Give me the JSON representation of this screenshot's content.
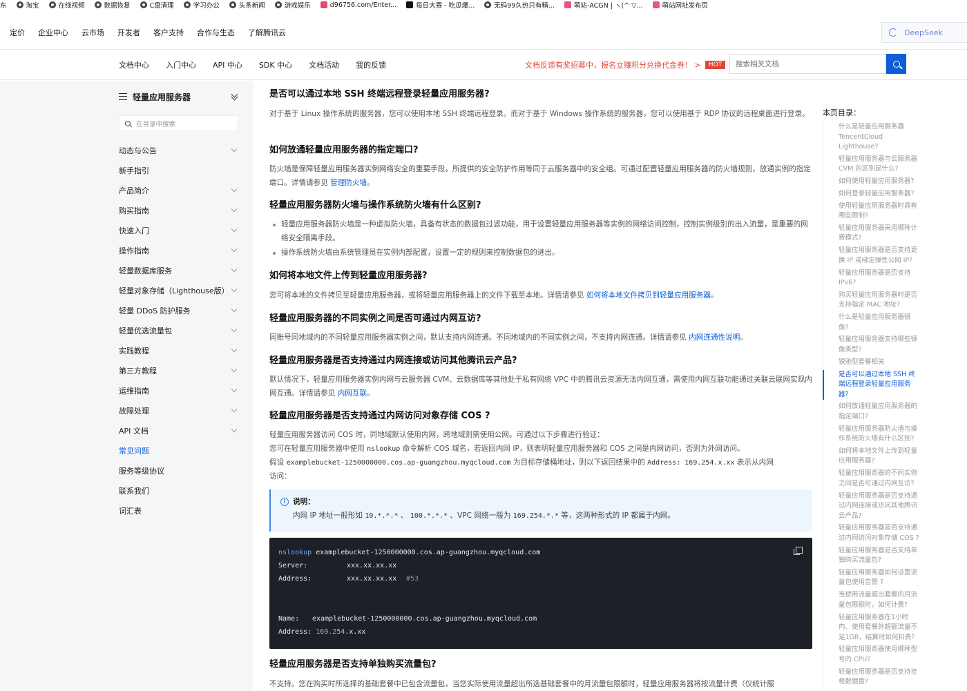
{
  "bookmarks": [
    {
      "label": "东",
      "icon": "none"
    },
    {
      "label": "淘宝",
      "icon": "globe-icon"
    },
    {
      "label": "在线视频",
      "icon": "globe-icon"
    },
    {
      "label": "数据恢复",
      "icon": "globe-icon"
    },
    {
      "label": "C盘清理",
      "icon": "globe-icon"
    },
    {
      "label": "学习办公",
      "icon": "globe-icon"
    },
    {
      "label": "头条新闻",
      "icon": "globe-icon"
    },
    {
      "label": "游戏娱乐",
      "icon": "globe-icon"
    },
    {
      "label": "d96756.com/Enter...",
      "icon": "site-icon"
    },
    {
      "label": "每日大赛 - 吃瓜爆...",
      "icon": "site-icon"
    },
    {
      "label": "无码99久热只有精...",
      "icon": "globe-icon"
    },
    {
      "label": "萌站-ACGN | ヽ(^ ▽...",
      "icon": "site-icon"
    },
    {
      "label": "萌站网址发布页",
      "icon": "site-icon"
    }
  ],
  "topnav": {
    "items": [
      "定价",
      "企业中心",
      "云市场",
      "开发者",
      "客户支持",
      "合作与生态",
      "了解腾讯云"
    ],
    "deepseek_label": "DeepSeek"
  },
  "docnav": {
    "tabs": [
      "文档中心",
      "入门中心",
      "API 中心",
      "SDK 中心",
      "文档活动",
      "我的反馈"
    ],
    "promo": "文档反馈有奖招募中，报名立赚积分兑换代金券！ >",
    "hot": "HOT",
    "search_placeholder": "搜索相关文档"
  },
  "sidebar": {
    "title": "轻量应用服务器",
    "search_placeholder": "在目录中搜索",
    "items": [
      {
        "label": "动态与公告",
        "expandable": true
      },
      {
        "label": "新手指引",
        "expandable": false
      },
      {
        "label": "产品简介",
        "expandable": true
      },
      {
        "label": "购买指南",
        "expandable": true
      },
      {
        "label": "快速入门",
        "expandable": true
      },
      {
        "label": "操作指南",
        "expandable": true
      },
      {
        "label": "轻量数据库服务",
        "expandable": true
      },
      {
        "label": "轻量对象存储（Lighthouse版）",
        "expandable": true
      },
      {
        "label": "轻量 DDoS 防护服务",
        "expandable": true
      },
      {
        "label": "轻量优选流量包",
        "expandable": true
      },
      {
        "label": "实践教程",
        "expandable": true
      },
      {
        "label": "第三方教程",
        "expandable": true
      },
      {
        "label": "运维指南",
        "expandable": true
      },
      {
        "label": "故障处理",
        "expandable": true
      },
      {
        "label": "API 文档",
        "expandable": true
      },
      {
        "label": "常见问题",
        "expandable": false,
        "active": true
      },
      {
        "label": "服务等级协议",
        "expandable": false
      },
      {
        "label": "联系我们",
        "expandable": false
      },
      {
        "label": "词汇表",
        "expandable": false
      }
    ]
  },
  "content": {
    "s1": {
      "heading": "是否可以通过本地 SSH 终端远程登录轻量应用服务器?",
      "body": "对于基于 Linux 操作系统的服务器，您可以使用本地 SSH 终端远程登录。而对于基于 Windows 操作系统的服务器，您可以使用基于 RDP 协议的远程桌面进行登录。"
    },
    "s2": {
      "heading": "如何放通轻量应用服务器的指定端口?",
      "body": "防火墙是保障轻量应用服务器实例网络安全的重要手段，所提供的安全防护作用等同于云服务器中的安全组。可通过配置轻量应用服务器的防火墙规则，放通实例的指定端口。详情请参见 ",
      "link": "管理防火墙",
      "tail": "。"
    },
    "s3": {
      "heading": "轻量应用服务器防火墙与操作系统防火墙有什么区别?",
      "bullets": [
        "轻量应用服务器防火墙是一种虚拟防火墙，具备有状态的数据包过滤功能，用于设置轻量应用服务器等实例的网络访问控制，控制实例级别的出入流量，是重要的网络安全隔离手段。",
        "操作系统防火墙由系统管理员在实例内部配置，设置一定的规则来控制数据包的进出。"
      ]
    },
    "s4": {
      "heading": "如何将本地文件上传到轻量应用服务器?",
      "body": "您可将本地的文件拷贝至轻量应用服务器，或将轻量应用服务器上的文件下载至本地。详情请参见 ",
      "link": "如何将本地文件拷贝到轻量应用服务器",
      "tail": "。"
    },
    "s5": {
      "heading": "轻量应用服务器的不同实例之间是否可通过内网互访?",
      "body": "同账号同地域内的不同轻量应用服务器实例之间，默认支持内网连通。不同地域内的不同实例之间，不支持内网连通。详情请参见 ",
      "link": "内网连通性说明",
      "tail": "。"
    },
    "s6": {
      "heading": "轻量应用服务器是否支持通过内网连接或访问其他腾讯云产品?",
      "body": "默认情况下，轻量应用服务器实例内网与云服务器 CVM、云数据库等其他处于私有网络 VPC 中的腾讯云资源无法内网互通，需使用内网互联功能通过关联云联网实现内网互通。详情请参见 ",
      "link": "内网互联",
      "tail": "。"
    },
    "s7": {
      "heading": "轻量应用服务器是否支持通过内网访问对象存储 COS ?",
      "line1": "轻量应用服务器访问 COS 时，同地域默认使用内网，跨地域则需使用公网。可通过以下步骤进行验证：",
      "line2_a": "您可在轻量应用服务器中使用 ",
      "line2_code": "nslookup",
      "line2_b": " 命令解析 COS 域名，若返回内网 IP，则表明轻量应用服务器和 COS 之间是内网访问，否则为外网访问。",
      "line3_a": "假设 ",
      "line3_code1": "examplebucket-1250000000.cos.ap-guangzhou.myqcloud.com",
      "line3_b": " 为目标存储桶地址，则以下返回结果中的 ",
      "line3_code2": "Address: 169.254.x.xx",
      "line3_c": " 表示从内网",
      "line4": "访问："
    },
    "note": {
      "title": "说明：",
      "text_a": "内网 IP 地址一般形如 ",
      "code1": "10.*.*.*",
      "sep": " 、 ",
      "code2": "100.*.*.*",
      "text_b": " 、VPC 网络一般为 ",
      "code3": "169.254.*.*",
      "text_c": " 等，这两种形式的 IP 都属于内网。"
    },
    "code": {
      "cmd": "nslookup",
      "cmd_arg": " examplebucket-1250000000.cos.ap-guangzhou.myqcloud.com",
      "server_label": "Server:",
      "server_val": "xxx.xx.xx.xx",
      "addr_label": "Address:",
      "addr_val": "xxx.xx.xx.xx",
      "addr_comment": "#53",
      "name_label": "Name:",
      "name_val": "examplebucket-1250000000.cos.ap-guangzhou.myqcloud.com",
      "addr2_label": "Address: ",
      "addr2_num": "169.254",
      "addr2_rest": ".x.xx"
    },
    "s8": {
      "heading": "轻量应用服务器是否支持单独购买流量包?",
      "body": "不支持。您在购买时所选择的基础套餐中已包含流量包，当您实际使用流量超出所选基础套餐中的月流量包限额时，轻量应用服务器将按流量计费（仅统计服"
    }
  },
  "toc": {
    "title": "本页目录：",
    "items": [
      {
        "label": "什么是轻量应用服务器 TencentCloud Lighthouse?"
      },
      {
        "label": "轻量应用服务器与云服务器 CVM 的区别是什么?"
      },
      {
        "label": "如何使用轻量应用服务器?"
      },
      {
        "label": "如何登录轻量应用服务器?"
      },
      {
        "label": "使用轻量应用服务器时具有哪些限制?"
      },
      {
        "label": "轻量应用服务器采用哪种计费模式?"
      },
      {
        "label": "轻量应用服务器是否支持更换 IP 或绑定弹性公网 IP?"
      },
      {
        "label": "轻量应用服务器是否支持 IPv6?"
      },
      {
        "label": "购买轻量应用服务器时是否支持指定 MAC 地址?"
      },
      {
        "label": "什么是轻量应用服务器镜像?"
      },
      {
        "label": "轻量应用服务器支持哪些镜像类型?"
      },
      {
        "label": "锐驰型套餐相关"
      },
      {
        "label": "是否可以通过本地 SSH 终端远程登录轻量应用服务器?",
        "active": true
      },
      {
        "label": "如何放通轻量应用服务器的指定端口?"
      },
      {
        "label": "轻量应用服务器防火墙与操作系统防火墙有什么区别?"
      },
      {
        "label": "如何将本地文件上传到轻量应用服务器?"
      },
      {
        "label": "轻量应用服务器的不同实例之间是否可通过内网互访?"
      },
      {
        "label": "轻量应用服务器是否支持通过内网连接或访问其他腾讯云产品?"
      },
      {
        "label": "轻量应用服务器是否支持通过内网访问对象存储 COS ?"
      },
      {
        "label": "轻量应用服务器是否支持单独购买流量包?"
      },
      {
        "label": "轻量应用服务器如何设置流量包使用告警 ?"
      },
      {
        "label": "当使用流量超出套餐的月流量包限额时，如何计费?"
      },
      {
        "label": "轻量应用服务器在1小时内、使用套餐外超额流量不足1GB，结算时如何扣费?"
      },
      {
        "label": "轻量应用服务器使用哪种型号的 CPU?"
      },
      {
        "label": "轻量应用服务器是否支持挂载数据盘?"
      }
    ]
  }
}
